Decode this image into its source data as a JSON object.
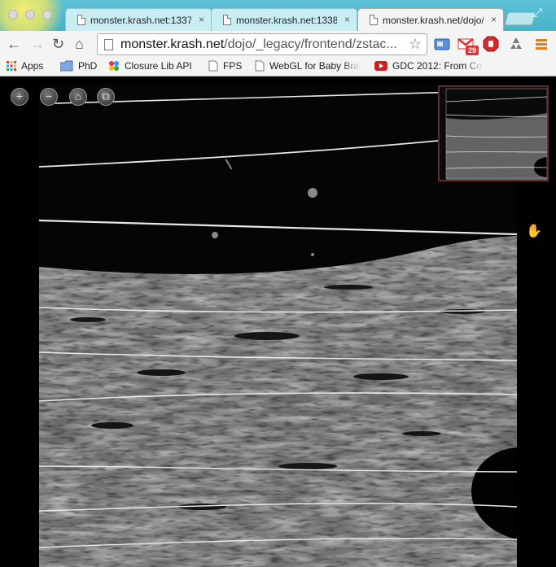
{
  "browser": {
    "tabs": [
      {
        "title": "monster.krash.net:1337",
        "close": "×"
      },
      {
        "title": "monster.krash.net:1338",
        "close": "×"
      },
      {
        "title": "monster.krash.net/dojo/",
        "close": "×"
      }
    ],
    "url": {
      "host": "monster.krash.net",
      "path": "/dojo/_legacy/frontend/zstac..."
    },
    "notification_count": "29",
    "bookmarks": [
      {
        "label": "Apps",
        "icon": "apps-grid-icon"
      },
      {
        "label": "PhD",
        "icon": "folder-icon"
      },
      {
        "label": "Closure Lib API",
        "icon": "closure-icon"
      },
      {
        "label": "FPS",
        "icon": "page-icon"
      },
      {
        "label": "WebGL for Baby Brai",
        "icon": "page-icon"
      },
      {
        "label": "GDC 2012: From Co",
        "icon": "youtube-icon"
      }
    ]
  },
  "viewer": {
    "controls": [
      "zoom-in",
      "zoom-out",
      "home",
      "fullscreen"
    ],
    "control_glyphs": [
      "+",
      "−",
      "⌂",
      "⧉"
    ],
    "overview_border_color": "#6b2a2a"
  }
}
